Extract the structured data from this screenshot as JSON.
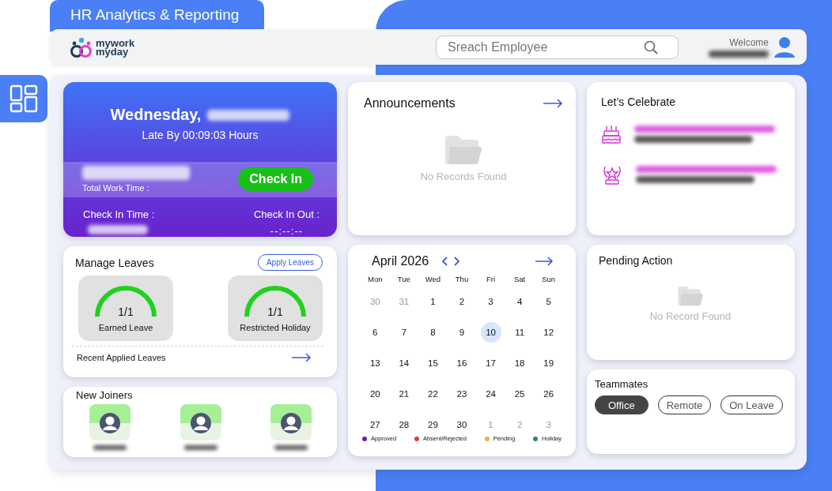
{
  "title_tab": "HR Analytics & Reporting",
  "logo": {
    "lines": [
      "mywork",
      "myday"
    ]
  },
  "search": {
    "placeholder": "Sreach Employee"
  },
  "user": {
    "greeting": "Welcome"
  },
  "attendance": {
    "day": "Wednesday,",
    "late": "Late By 00:09:03 Hours",
    "total_label": "Total Work Time :",
    "button": "Check In",
    "check_in_label": "Check In Time :",
    "check_out_label": "Check In Out :",
    "check_out_value": "--:--:--"
  },
  "announcements": {
    "title": "Announcements",
    "empty": "No Records Found"
  },
  "celebrate": {
    "title": "Let’s Celebrate",
    "items": [
      {
        "kind": "birthday"
      },
      {
        "kind": "anniversary"
      }
    ]
  },
  "leaves": {
    "title": "Manage Leaves",
    "apply": "Apply Leaves",
    "balances": [
      {
        "count": "1/1",
        "label": "Earned Leave"
      },
      {
        "count": "1/1",
        "label": "Restricted Holiday"
      }
    ],
    "recent": "Recent Applied Leaves"
  },
  "joiners": {
    "title": "New Joiners",
    "people": [
      {
        "kind": "avatar"
      },
      {
        "kind": "avatar"
      },
      {
        "kind": "avatar"
      }
    ]
  },
  "calendar": {
    "title": "April 2026",
    "weekdays": [
      "Mon",
      "Tue",
      "Wed",
      "Thu",
      "Fri",
      "Sat",
      "Sun"
    ],
    "days": [
      {
        "day": "30",
        "muted": true,
        "selected": false
      },
      {
        "day": "31",
        "muted": true,
        "selected": false
      },
      {
        "day": "1",
        "muted": false,
        "selected": false
      },
      {
        "day": "2",
        "muted": false,
        "selected": false
      },
      {
        "day": "3",
        "muted": false,
        "selected": false
      },
      {
        "day": "4",
        "muted": false,
        "selected": false
      },
      {
        "day": "5",
        "muted": false,
        "selected": false
      },
      {
        "day": "6",
        "muted": false,
        "selected": false
      },
      {
        "day": "7",
        "muted": false,
        "selected": false
      },
      {
        "day": "8",
        "muted": false,
        "selected": false
      },
      {
        "day": "9",
        "muted": false,
        "selected": false
      },
      {
        "day": "10",
        "muted": false,
        "selected": true
      },
      {
        "day": "11",
        "muted": false,
        "selected": false
      },
      {
        "day": "12",
        "muted": false,
        "selected": false
      },
      {
        "day": "13",
        "muted": false,
        "selected": false
      },
      {
        "day": "14",
        "muted": false,
        "selected": false
      },
      {
        "day": "15",
        "muted": false,
        "selected": false
      },
      {
        "day": "16",
        "muted": false,
        "selected": false
      },
      {
        "day": "17",
        "muted": false,
        "selected": false
      },
      {
        "day": "18",
        "muted": false,
        "selected": false
      },
      {
        "day": "19",
        "muted": false,
        "selected": false
      },
      {
        "day": "20",
        "muted": false,
        "selected": false
      },
      {
        "day": "21",
        "muted": false,
        "selected": false
      },
      {
        "day": "22",
        "muted": false,
        "selected": false
      },
      {
        "day": "23",
        "muted": false,
        "selected": false
      },
      {
        "day": "24",
        "muted": false,
        "selected": false
      },
      {
        "day": "25",
        "muted": false,
        "selected": false
      },
      {
        "day": "26",
        "muted": false,
        "selected": false
      },
      {
        "day": "27",
        "muted": false,
        "selected": false
      },
      {
        "day": "28",
        "muted": false,
        "selected": false
      },
      {
        "day": "29",
        "muted": false,
        "selected": false
      },
      {
        "day": "30",
        "muted": false,
        "selected": false
      },
      {
        "day": "1",
        "muted": true,
        "selected": false
      },
      {
        "day": "2",
        "muted": true,
        "selected": false
      },
      {
        "day": "3",
        "muted": true,
        "selected": false
      }
    ],
    "legend": [
      {
        "label": "Approved",
        "color": "#6a1fb5"
      },
      {
        "label": "Absent/Rejected",
        "color": "#e0393e"
      },
      {
        "label": "Pending",
        "color": "#e8b83a"
      },
      {
        "label": "Holiday",
        "color": "#2e8b57"
      }
    ]
  },
  "pending": {
    "title": "Pending Action",
    "empty": "No Record Found"
  },
  "teammates": {
    "title": "Teammates",
    "tabs": [
      {
        "label": "Office",
        "selected": true
      },
      {
        "label": "Remote",
        "selected": false
      },
      {
        "label": "On Leave",
        "selected": false
      }
    ]
  }
}
